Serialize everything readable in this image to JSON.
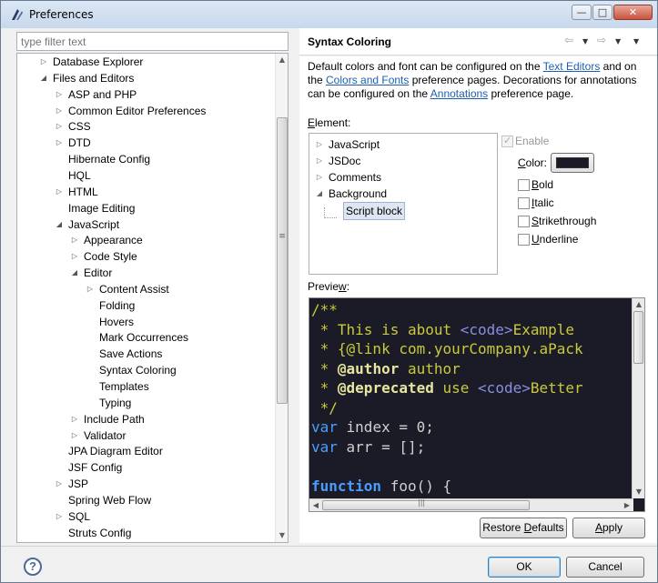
{
  "window": {
    "title": "Preferences",
    "min_glyph": "—",
    "max_glyph": "□",
    "close_glyph": "✕"
  },
  "filter": {
    "placeholder": "type filter text",
    "value": ""
  },
  "tree": {
    "items": [
      {
        "label": "Database Explorer",
        "depth": 1,
        "arrow": "right"
      },
      {
        "label": "Files and Editors",
        "depth": 1,
        "arrow": "down"
      },
      {
        "label": "ASP and PHP",
        "depth": 2,
        "arrow": "right"
      },
      {
        "label": "Common Editor Preferences",
        "depth": 2,
        "arrow": "right"
      },
      {
        "label": "CSS",
        "depth": 2,
        "arrow": "right"
      },
      {
        "label": "DTD",
        "depth": 2,
        "arrow": "right"
      },
      {
        "label": "Hibernate Config",
        "depth": 2,
        "arrow": "none"
      },
      {
        "label": "HQL",
        "depth": 2,
        "arrow": "none"
      },
      {
        "label": "HTML",
        "depth": 2,
        "arrow": "right"
      },
      {
        "label": "Image Editing",
        "depth": 2,
        "arrow": "none"
      },
      {
        "label": "JavaScript",
        "depth": 2,
        "arrow": "down"
      },
      {
        "label": "Appearance",
        "depth": 3,
        "arrow": "right"
      },
      {
        "label": "Code Style",
        "depth": 3,
        "arrow": "right"
      },
      {
        "label": "Editor",
        "depth": 3,
        "arrow": "down"
      },
      {
        "label": "Content Assist",
        "depth": 4,
        "arrow": "right"
      },
      {
        "label": "Folding",
        "depth": 4,
        "arrow": "none"
      },
      {
        "label": "Hovers",
        "depth": 4,
        "arrow": "none"
      },
      {
        "label": "Mark Occurrences",
        "depth": 4,
        "arrow": "none"
      },
      {
        "label": "Save Actions",
        "depth": 4,
        "arrow": "none"
      },
      {
        "label": "Syntax Coloring",
        "depth": 4,
        "arrow": "none",
        "selected": true
      },
      {
        "label": "Templates",
        "depth": 4,
        "arrow": "none"
      },
      {
        "label": "Typing",
        "depth": 4,
        "arrow": "none"
      },
      {
        "label": "Include Path",
        "depth": 3,
        "arrow": "right"
      },
      {
        "label": "Validator",
        "depth": 3,
        "arrow": "right"
      },
      {
        "label": "JPA Diagram Editor",
        "depth": 2,
        "arrow": "none"
      },
      {
        "label": "JSF Config",
        "depth": 2,
        "arrow": "none"
      },
      {
        "label": "JSP",
        "depth": 2,
        "arrow": "right"
      },
      {
        "label": "Spring Web Flow",
        "depth": 2,
        "arrow": "none"
      },
      {
        "label": "SQL",
        "depth": 2,
        "arrow": "right"
      },
      {
        "label": "Struts Config",
        "depth": 2,
        "arrow": "none"
      }
    ]
  },
  "page": {
    "title": "Syntax Coloring",
    "desc_1": "Default colors and font can be configured on the ",
    "link_text_editors": "Text Editors",
    "desc_2": " and on the ",
    "link_colors_fonts": "Colors and Fonts",
    "desc_3": " preference pages.  Decorations for annotations can be configured on the ",
    "link_annotations": "Annotations",
    "desc_4": " preference page.",
    "element_label_pre": "",
    "element_label_mn": "E",
    "element_label_post": "lement:",
    "elements": [
      {
        "label": "JavaScript",
        "arrow": "right"
      },
      {
        "label": "JSDoc",
        "arrow": "right"
      },
      {
        "label": "Comments",
        "arrow": "right"
      },
      {
        "label": "Background",
        "arrow": "down"
      },
      {
        "label": "Script block",
        "arrow": "none",
        "child": true,
        "selected": true
      }
    ],
    "enable_label": "Enable",
    "color_label_mn": "C",
    "color_label_rest": "olor:",
    "color_value": "#1b1b27",
    "options": [
      {
        "mn": "B",
        "rest": "old"
      },
      {
        "mn": "I",
        "rest": "talic"
      },
      {
        "mn": "S",
        "rest": "trikethrough"
      },
      {
        "mn": "U",
        "rest": "nderline"
      }
    ],
    "preview_label_pre": "Previe",
    "preview_label_mn": "w",
    "preview_label_post": ":",
    "restore_defaults_pre": "Restore ",
    "restore_defaults_mn": "D",
    "restore_defaults_post": "efaults",
    "apply_mn": "A",
    "apply_rest": "pply"
  },
  "code_lines": [
    [
      {
        "c": "cm",
        "t": "/**"
      }
    ],
    [
      {
        "c": "cm",
        "t": " * This is about "
      },
      {
        "c": "tag",
        "t": "<code>"
      },
      {
        "c": "cm",
        "t": "Example"
      }
    ],
    [
      {
        "c": "cm",
        "t": " * {@link com.yourCompany.aPack"
      }
    ],
    [
      {
        "c": "cm",
        "t": " * "
      },
      {
        "c": "dec",
        "t": "@author"
      },
      {
        "c": "cm",
        "t": " author"
      }
    ],
    [
      {
        "c": "cm",
        "t": " * "
      },
      {
        "c": "dec",
        "t": "@deprecated"
      },
      {
        "c": "cm",
        "t": " use "
      },
      {
        "c": "tag",
        "t": "<code>"
      },
      {
        "c": "cm",
        "t": "Better"
      }
    ],
    [
      {
        "c": "cm",
        "t": " */"
      }
    ],
    [
      {
        "c": "kw",
        "t": "var"
      },
      {
        "c": "fn",
        "t": " index = 0;"
      }
    ],
    [
      {
        "c": "kw",
        "t": "var"
      },
      {
        "c": "fn",
        "t": " arr = [];"
      }
    ],
    [
      {
        "c": "fn",
        "t": ""
      }
    ],
    [
      {
        "c": "kwb",
        "t": "function"
      },
      {
        "c": "fn",
        "t": " foo() {"
      }
    ]
  ],
  "buttons": {
    "ok": "OK",
    "cancel": "Cancel",
    "help": "?"
  },
  "scroll": {
    "grip": "≡",
    "hgrip": "|||"
  }
}
